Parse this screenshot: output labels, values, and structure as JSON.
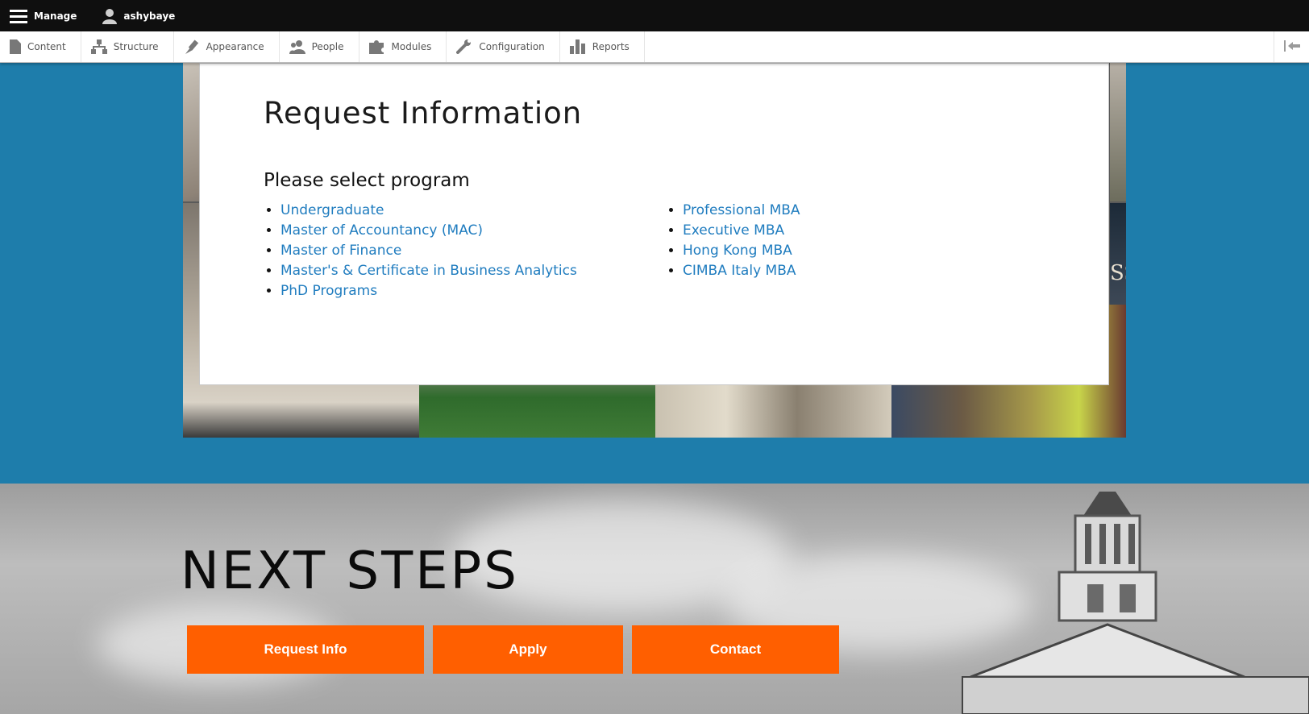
{
  "toolbar": {
    "manage_label": "Manage",
    "user_label": "ashybaye",
    "tray": [
      {
        "label": "Content",
        "icon": "file-icon"
      },
      {
        "label": "Structure",
        "icon": "sitemap-icon"
      },
      {
        "label": "Appearance",
        "icon": "brush-icon"
      },
      {
        "label": "People",
        "icon": "people-icon"
      },
      {
        "label": "Modules",
        "icon": "puzzle-icon"
      },
      {
        "label": "Configuration",
        "icon": "wrench-icon"
      },
      {
        "label": "Reports",
        "icon": "bar-chart-icon"
      }
    ]
  },
  "modal": {
    "title": "Request Information",
    "subtitle": "Please select program",
    "programs_left": [
      "Undergraduate",
      "Master of Accountancy (MAC)",
      "Master of Finance",
      "Master's & Certificate in Business Analytics",
      "PhD Programs"
    ],
    "programs_right": [
      "Professional MBA",
      "Executive MBA",
      "Hong Kong MBA",
      "CIMBA Italy MBA"
    ]
  },
  "collage": {
    "partial_text": "SS"
  },
  "next_steps": {
    "title": "NEXT STEPS",
    "buttons": [
      "Request Info",
      "Apply",
      "Contact"
    ]
  },
  "colors": {
    "toolbar_bg": "#0f0f0f",
    "band_blue": "#1e7dab",
    "link_blue": "#1f7cbf",
    "cta_orange": "#ff5f00"
  }
}
